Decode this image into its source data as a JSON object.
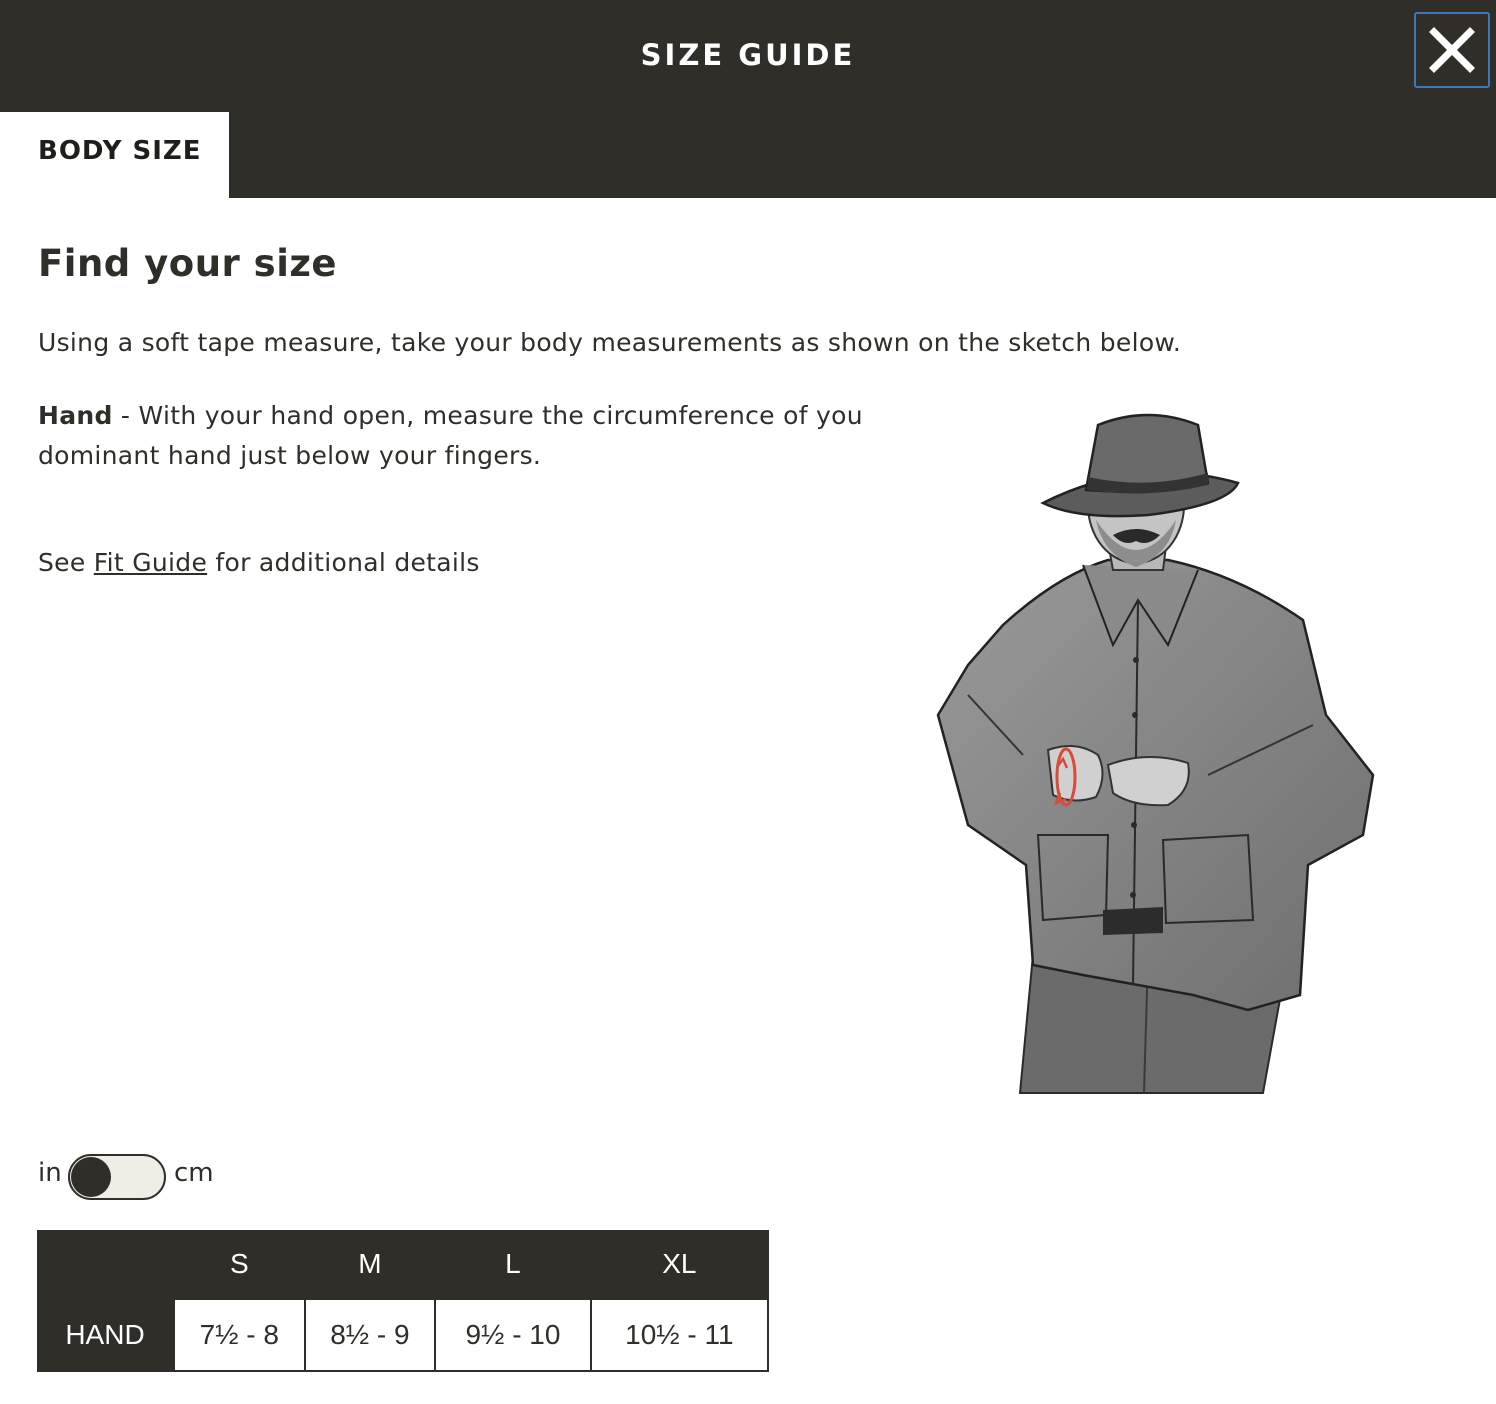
{
  "header": {
    "title": "SIZE GUIDE",
    "close_icon": "close-icon"
  },
  "tabs": [
    {
      "label": "BODY SIZE",
      "active": true
    }
  ],
  "content": {
    "title": "Find your size",
    "intro": "Using a soft tape measure, take your body measurements as shown on the sketch below.",
    "hand_label": "Hand",
    "hand_text": " - With your hand open, measure the circumference of you dominant hand just below your fingers.",
    "fit_prefix": "See ",
    "fit_link": "Fit Guide",
    "fit_suffix": " for additional details"
  },
  "units": {
    "left": "in",
    "right": "cm",
    "selected": "in"
  },
  "table": {
    "columns": [
      "S",
      "M",
      "L",
      "XL"
    ],
    "rows": [
      {
        "label": "HAND",
        "values": [
          "7½ - 8",
          "8½ - 9",
          "9½ - 10",
          "10½ - 11"
        ]
      }
    ]
  },
  "colors": {
    "header_bg": "#302e29",
    "text": "#2f2e29",
    "measure_accent": "#d84a3a",
    "focus_ring": "#3f78b8"
  }
}
